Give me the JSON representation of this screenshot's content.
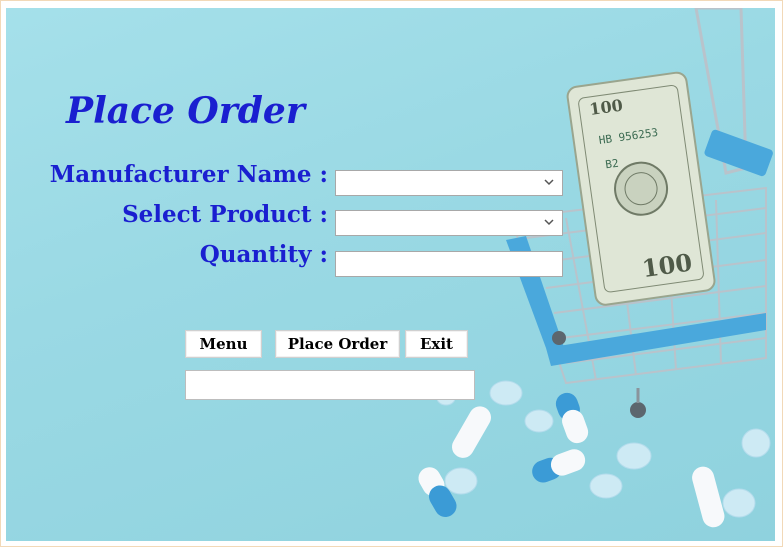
{
  "form": {
    "title": "Place Order",
    "manufacturer_label": "Manufacturer Name :",
    "product_label": "Select Product :",
    "quantity_label": "Quantity :",
    "manufacturer_value": "",
    "product_value": "",
    "quantity_value": "",
    "status_value": ""
  },
  "buttons": {
    "menu": "Menu",
    "place_order": "Place Order",
    "exit": "Exit"
  },
  "icons": {
    "dropdown": "chevron-down-icon"
  },
  "colors": {
    "background": "#9ad9e4",
    "title_text": "#1a1fd0",
    "label_text": "#1a1fd0",
    "cart_frame": "#4aa8dc",
    "pill_blue": "#3b9bd6",
    "banknote": "#dfe6d6"
  }
}
